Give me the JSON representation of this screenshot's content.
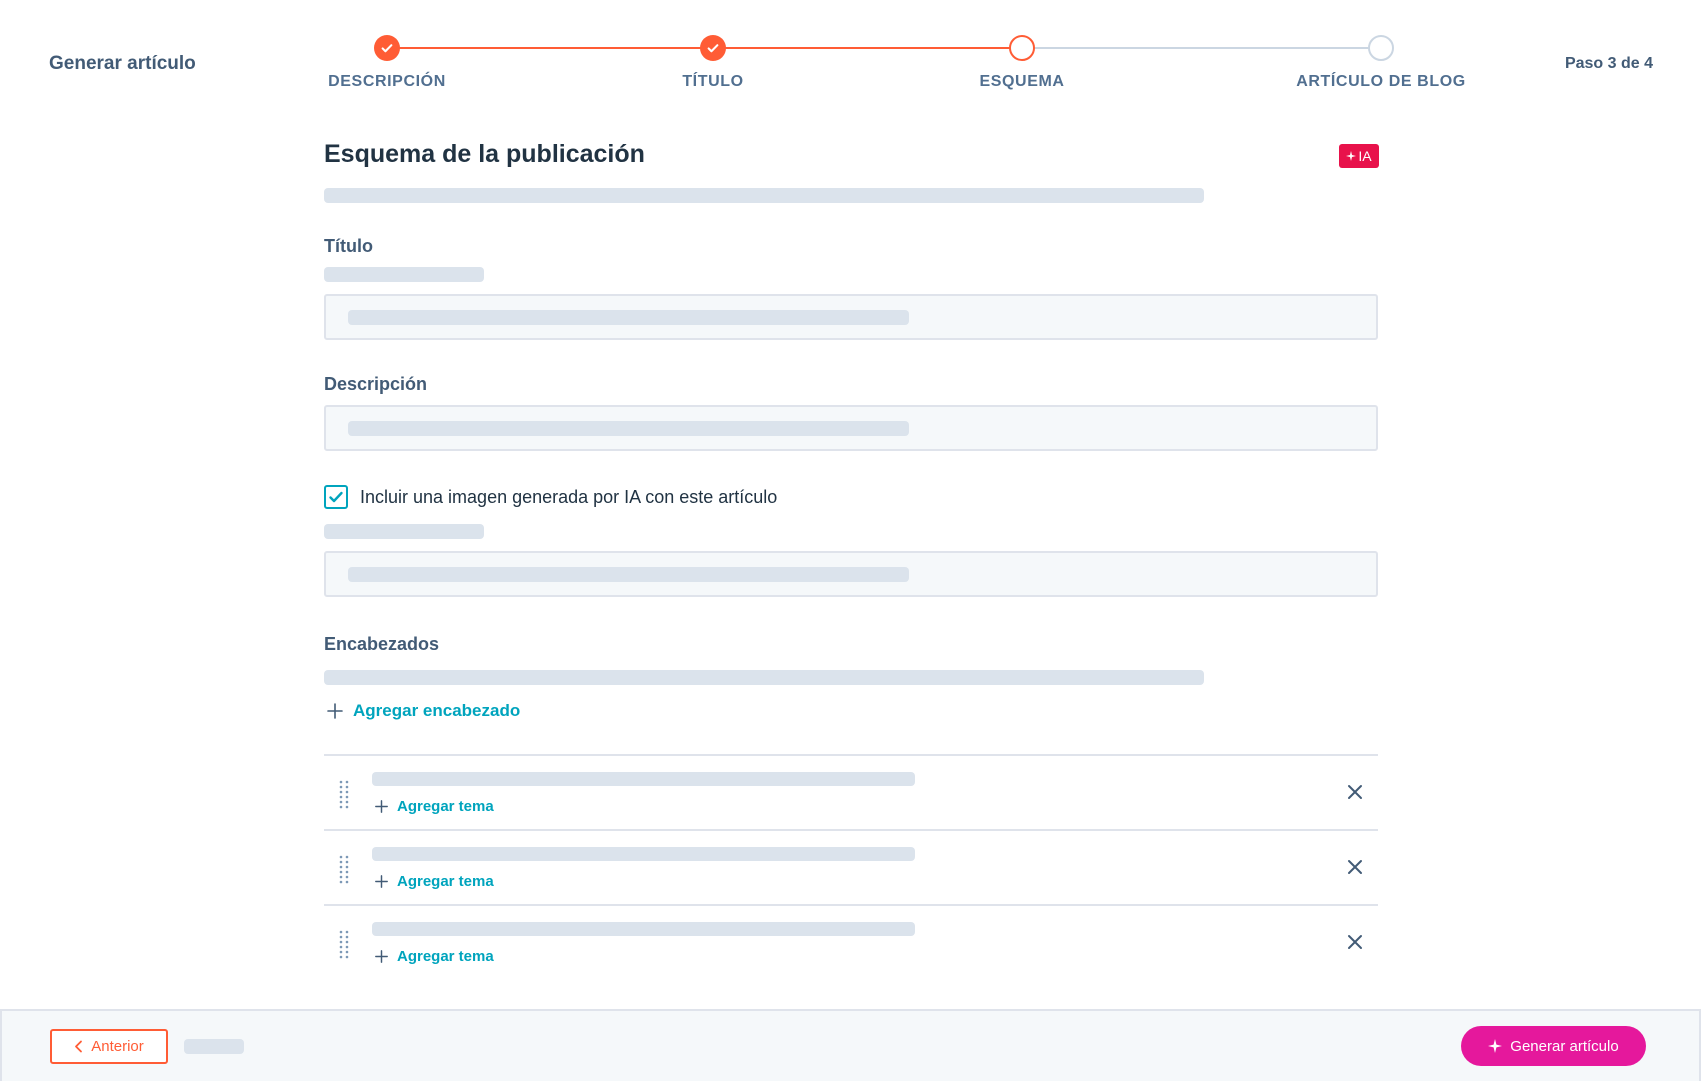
{
  "header": {
    "app_title": "Generar artículo",
    "step_counter": "Paso 3 de 4"
  },
  "stepper": {
    "steps": [
      {
        "label": "DESCRIPCIÓN",
        "status": "done"
      },
      {
        "label": "TÍTULO",
        "status": "done"
      },
      {
        "label": "ESQUEMA",
        "status": "current"
      },
      {
        "label": "ARTÍCULO DE BLOG",
        "status": "todo"
      }
    ]
  },
  "main": {
    "section_title": "Esquema de la publicación",
    "ai_badge": "IA",
    "title_label": "Título",
    "description_label": "Descripción",
    "include_image": {
      "label": "Incluir una imagen generada por IA con este artículo",
      "checked": true
    },
    "headings_label": "Encabezados",
    "add_heading": "Agregar encabezado",
    "headings": [
      {
        "add_topic": "Agregar tema"
      },
      {
        "add_topic": "Agregar tema"
      },
      {
        "add_topic": "Agregar tema"
      }
    ]
  },
  "footer": {
    "back_label": "Anterior",
    "generate_label": "Generar artículo"
  },
  "colors": {
    "accent_orange": "#ff5c35",
    "teal": "#00a4bd",
    "magenta": "#e5189c",
    "ai_badge": "#e8124b"
  },
  "icons": {
    "check": "check-icon",
    "sparkle": "sparkle-icon",
    "plus": "plus-icon",
    "close": "close-icon",
    "drag": "drag-handle-icon",
    "chevron_left": "chevron-left-icon"
  }
}
